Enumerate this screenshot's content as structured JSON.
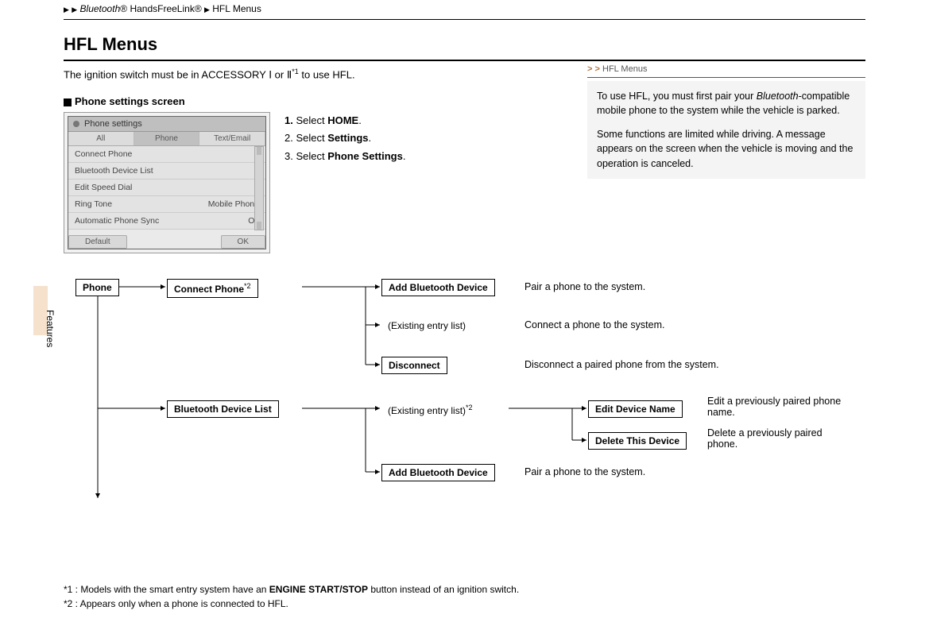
{
  "breadcrumb": {
    "item1": "Bluetooth",
    "reg1": "®",
    "item2": "HandsFreeLink",
    "reg2": "®",
    "item3": "HFL Menus"
  },
  "title": "HFL Menus",
  "ignition": {
    "prefix": "The ignition switch must be in ACCESSORY ",
    "modeA": "Ⅰ",
    "mid": " or ",
    "modeB": "Ⅱ",
    "sup": "*1",
    "suffix": " to use HFL."
  },
  "subhead": "Phone settings screen",
  "steps": {
    "s1a": "1.",
    "s1b": "Select ",
    "s1c": "HOME",
    "s1d": ".",
    "s2a": "2.",
    "s2b": " Select ",
    "s2c": "Settings",
    "s2d": ".",
    "s3a": "3.",
    "s3b": " Select ",
    "s3c": "Phone Settings",
    "s3d": "."
  },
  "mock": {
    "title": "Phone settings",
    "tabs": {
      "t1": "All",
      "t2": "Phone",
      "t3": "Text/Email"
    },
    "rows": {
      "r1": "Connect Phone",
      "r2": "Bluetooth Device List",
      "r3": "Edit Speed Dial",
      "r4": "Ring Tone",
      "r4v": "Mobile Phone",
      "r5": "Automatic Phone Sync",
      "r5v": "Off"
    },
    "b1": "Default",
    "b2": "OK"
  },
  "features_label": "Features",
  "info": {
    "crumb": "HFL Menus",
    "p1a": "To use HFL, you must first pair your ",
    "p1b": "Bluetooth",
    "p1c": "-compatible mobile phone to the system while the vehicle is parked.",
    "p2": "Some functions are limited while driving. A message appears on the screen when the vehicle is moving and the operation is canceled."
  },
  "diagram": {
    "phone": "Phone",
    "connect_phone": "Connect Phone",
    "connect_phone_sup": "*2",
    "add_bt": "Add Bluetooth Device",
    "add_bt_desc": "Pair a phone to the system.",
    "exist": "(Existing entry list)",
    "exist_desc": "Connect a phone to the system.",
    "disconnect": "Disconnect",
    "disconnect_desc": "Disconnect a paired phone from the system.",
    "bdl": "Bluetooth Device List",
    "exist2": "(Existing entry list)",
    "exist2_sup": "*2",
    "edn": "Edit Device Name",
    "edn_desc": "Edit a previously paired phone name.",
    "dtd": "Delete This Device",
    "dtd_desc": "Delete a previously paired phone.",
    "add_bt2": "Add Bluetooth Device",
    "add_bt2_desc": "Pair a phone to the system."
  },
  "footnotes": {
    "f1a": "*1 : Models with the smart entry system have an ",
    "f1b": "ENGINE START/STOP",
    "f1c": " button instead of an ignition switch.",
    "f2": "*2 : Appears only when a phone is connected to HFL."
  }
}
